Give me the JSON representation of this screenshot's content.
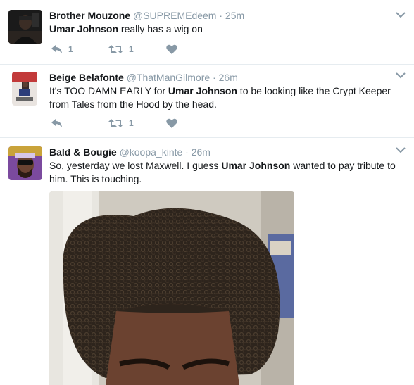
{
  "tweets": [
    {
      "name": "Brother Mouzone",
      "handle": "@SUPREMEdeem",
      "time": "25m",
      "text_parts": [
        {
          "t": "Umar Johnson",
          "b": true
        },
        {
          "t": " really has a wig on",
          "b": false
        }
      ],
      "reply_count": "1",
      "retweet_count": "1",
      "like_count": ""
    },
    {
      "name": "Beige Belafonte",
      "handle": "@ThatManGilmore",
      "time": "26m",
      "text_parts": [
        {
          "t": "It's TOO DAMN EARLY for ",
          "b": false
        },
        {
          "t": "Umar Johnson",
          "b": true
        },
        {
          "t": " to be looking like the Crypt Keeper from Tales from the Hood by the head.",
          "b": false
        }
      ],
      "reply_count": "",
      "retweet_count": "1",
      "like_count": ""
    },
    {
      "name": "Bald & Bougie",
      "handle": "@koopa_kinte",
      "time": "26m",
      "text_parts": [
        {
          "t": "So, yesterday we lost Maxwell. I guess ",
          "b": false
        },
        {
          "t": "Umar Johnson",
          "b": true
        },
        {
          "t": " wanted to pay tribute to him. This is touching.",
          "b": false
        }
      ]
    }
  ],
  "separator": " · ",
  "colors": {
    "text": "#14171a",
    "muted": "#8899a6",
    "divider": "#e6ecf0"
  },
  "icons": [
    "reply-icon",
    "retweet-icon",
    "like-icon",
    "chevron-down-icon"
  ]
}
